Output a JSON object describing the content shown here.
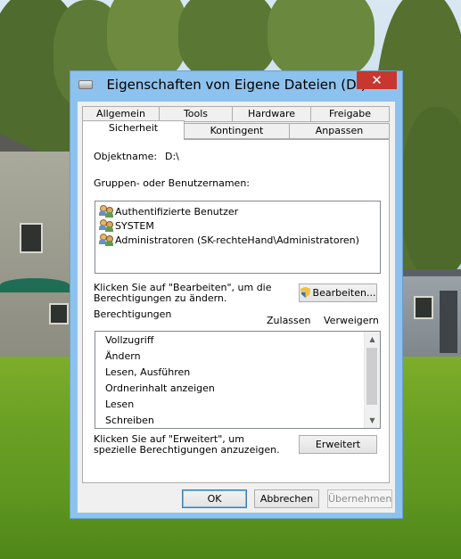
{
  "window": {
    "title": "Eigenschaften von Eigene Dateien (D:)",
    "close_glyph": "✕"
  },
  "tabs_row1": [
    "Allgemein",
    "Tools",
    "Hardware",
    "Freigabe"
  ],
  "tabs_row2": [
    "Sicherheit",
    "Kontingent",
    "Anpassen"
  ],
  "active_tab": "Sicherheit",
  "security": {
    "object_label": "Objektname:",
    "object_value": "D:\\",
    "groups_label": "Gruppen- oder Benutzernamen:",
    "groups": [
      "Authentifizierte Benutzer",
      "SYSTEM",
      "Administratoren (SK-rechteHand\\Administratoren)"
    ],
    "edit_hint": "Klicken Sie auf \"Bearbeiten\", um die Berechtigungen zu ändern.",
    "edit_button": "Bearbeiten...",
    "permissions_label": "Berechtigungen",
    "allow_header": "Zulassen",
    "deny_header": "Verweigern",
    "permissions": [
      "Vollzugriff",
      "Ändern",
      "Lesen, Ausführen",
      "Ordnerinhalt anzeigen",
      "Lesen",
      "Schreiben"
    ],
    "advanced_hint": "Klicken Sie auf \"Erweitert\", um spezielle Berechtigungen anzuzeigen.",
    "advanced_button": "Erweitert"
  },
  "footer": {
    "ok": "OK",
    "cancel": "Abbrechen",
    "apply": "Übernehmen"
  },
  "icons": {
    "users": "users-icon",
    "shield": "shield-icon",
    "scroll_up": "▲",
    "scroll_down": "▼"
  },
  "colors": {
    "frame": "#8ec2ee",
    "close": "#c7372f",
    "default_button_border": "#3c7fb1"
  }
}
